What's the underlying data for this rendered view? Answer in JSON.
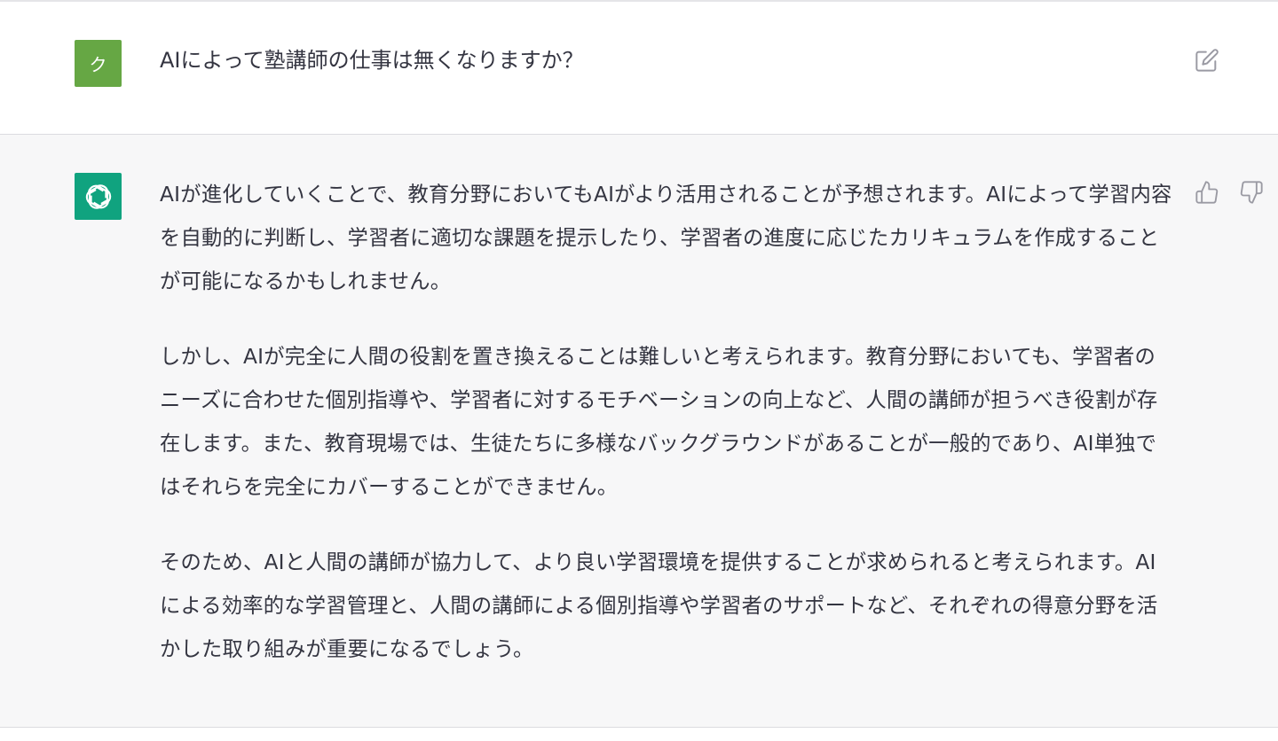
{
  "user_message": {
    "avatar_initial": "ク",
    "avatar_color": "#66a744",
    "text": "AIによって塾講師の仕事は無くなりますか？",
    "edit_icon": "edit-icon"
  },
  "assistant_message": {
    "avatar_icon": "openai-logo-icon",
    "avatar_color": "#10a37f",
    "paragraphs": [
      "AIが進化していくことで、教育分野においてもAIがより活用されることが予想されます。AIによって学習内容を自動的に判断し、学習者に適切な課題を提示したり、学習者の進度に応じたカリキュラムを作成することが可能になるかもしれません。",
      "しかし、AIが完全に人間の役割を置き換えることは難しいと考えられます。教育分野においても、学習者のニーズに合わせた個別指導や、学習者に対するモチベーションの向上など、人間の講師が担うべき役割が存在します。また、教育現場では、生徒たちに多様なバックグラウンドがあることが一般的であり、AI単独ではそれらを完全にカバーすることができません。",
      "そのため、AIと人間の講師が協力して、より良い学習環境を提供することが求められると考えられます。AIによる効率的な学習管理と、人間の講師による個別指導や学習者のサポートなど、それぞれの得意分野を活かした取り組みが重要になるでしょう。"
    ],
    "feedback_icons": [
      "thumbs-up-icon",
      "thumbs-down-icon"
    ]
  }
}
